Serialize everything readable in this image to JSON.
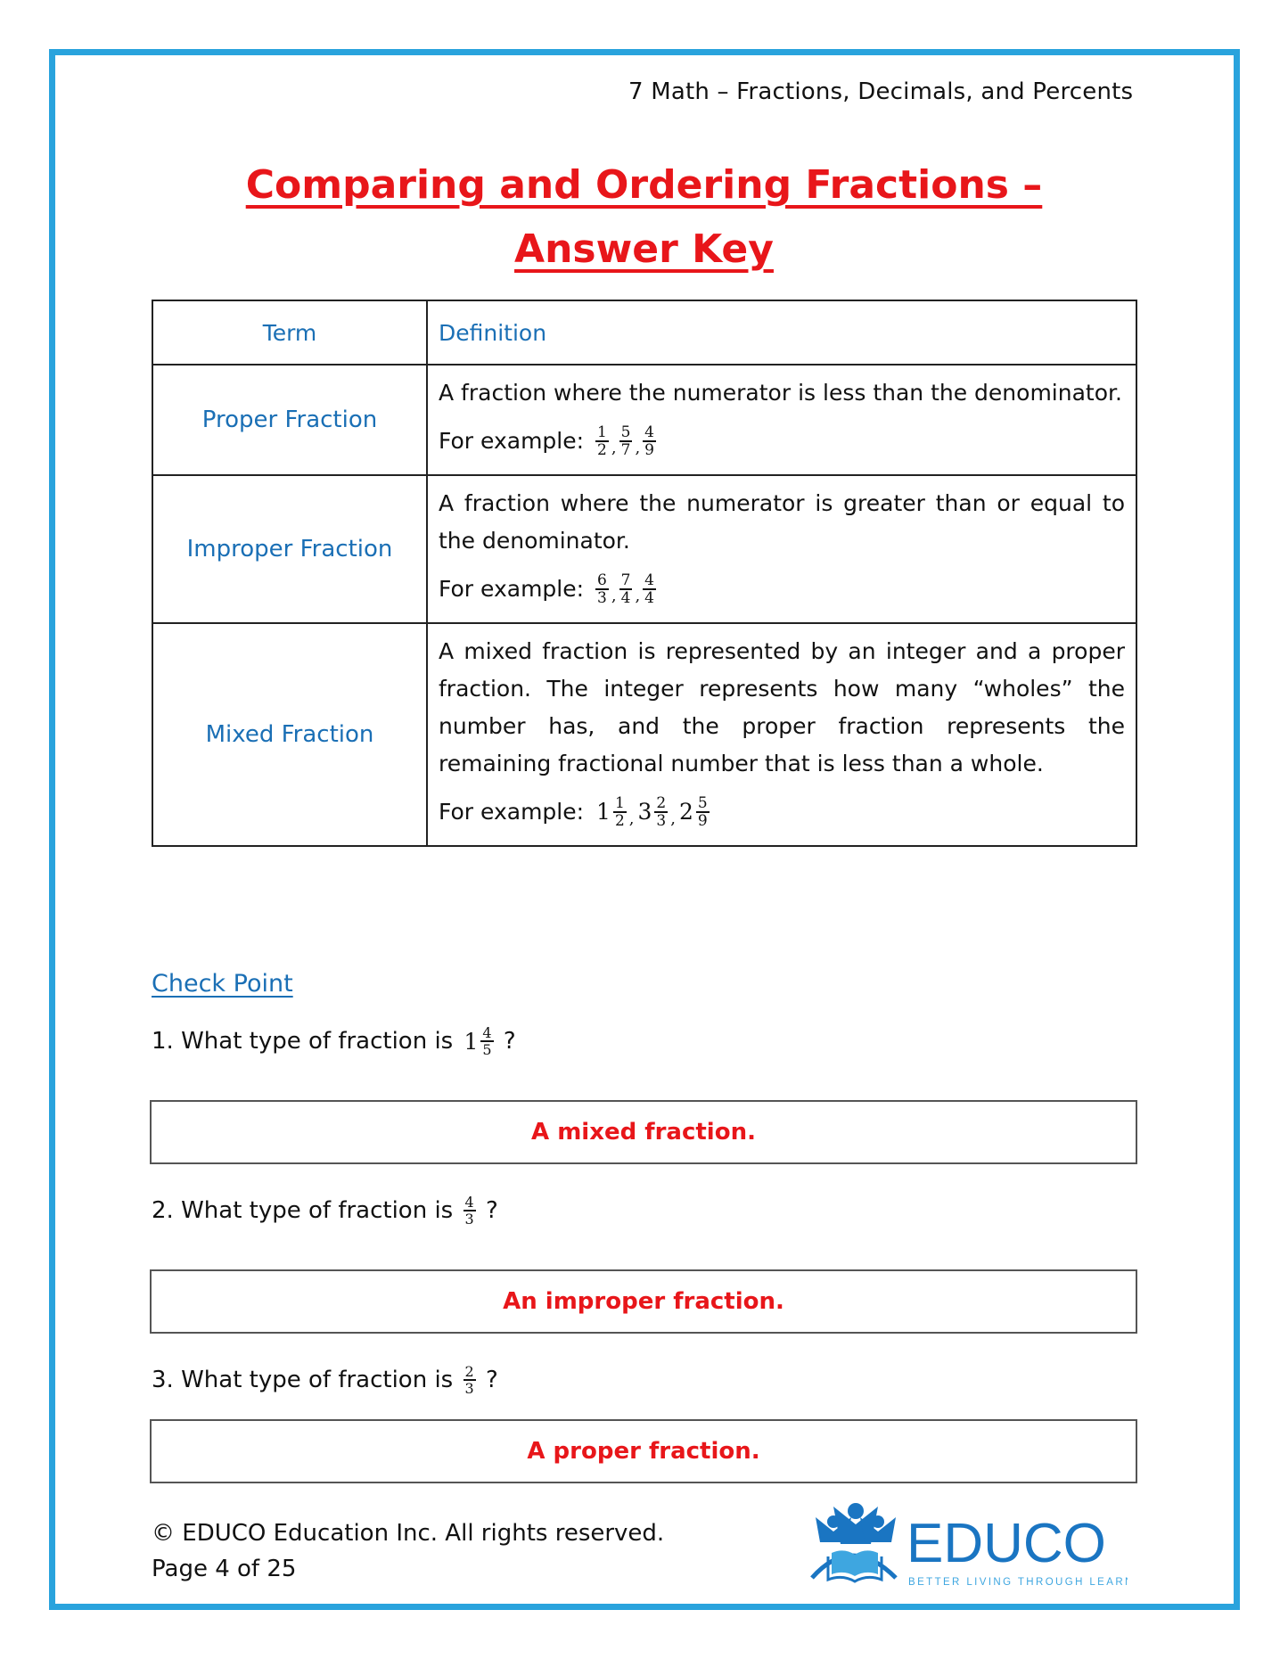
{
  "header": {
    "course_line": "7 Math – Fractions, Decimals, and Percents"
  },
  "title": "Comparing and Ordering Fractions – Answer Key",
  "table": {
    "headers": {
      "term": "Term",
      "definition": "Definition"
    },
    "rows": [
      {
        "term": "Proper Fraction",
        "definition": "A fraction where the numerator is less than the denominator.",
        "example_label": "For example:",
        "examples": [
          {
            "whole": "",
            "num": "1",
            "den": "2"
          },
          {
            "whole": "",
            "num": "5",
            "den": "7"
          },
          {
            "whole": "",
            "num": "4",
            "den": "9"
          }
        ]
      },
      {
        "term": "Improper Fraction",
        "definition": "A fraction where the numerator is greater than or equal to the denominator.",
        "example_label": "For example:",
        "examples": [
          {
            "whole": "",
            "num": "6",
            "den": "3"
          },
          {
            "whole": "",
            "num": "7",
            "den": "4"
          },
          {
            "whole": "",
            "num": "4",
            "den": "4"
          }
        ]
      },
      {
        "term": "Mixed Fraction",
        "definition": "A mixed fraction is represented by an integer and a proper fraction. The integer represents how many “wholes” the number has, and the proper fraction represents the remaining fractional number that is less than a whole.",
        "example_label": "For example:",
        "examples": [
          {
            "whole": "1",
            "num": "1",
            "den": "2"
          },
          {
            "whole": "3",
            "num": "2",
            "den": "3"
          },
          {
            "whole": "2",
            "num": "5",
            "den": "9"
          }
        ]
      }
    ]
  },
  "check_point": {
    "title": "Check Point",
    "questions": [
      {
        "prefix": "1. What type of fraction is",
        "whole": "1",
        "num": "4",
        "den": "5",
        "suffix": "?",
        "answer": "A mixed fraction."
      },
      {
        "prefix": "2. What type of fraction is",
        "whole": "",
        "num": "4",
        "den": "3",
        "suffix": "?",
        "answer": "An improper fraction."
      },
      {
        "prefix": "3. What type of fraction is",
        "whole": "",
        "num": "2",
        "den": "3",
        "suffix": "?",
        "answer": "A proper fraction."
      }
    ]
  },
  "footer": {
    "copyright": "© EDUCO Education Inc. All rights reserved.",
    "page": "Page 4 of 25"
  },
  "logo": {
    "name": "EDUCO",
    "tagline": "BETTER LIVING THROUGH LEARNING",
    "color": "#1a75c2",
    "accent": "#3ea6e0"
  },
  "colors": {
    "border": "#29a3dd",
    "title": "#e8161a",
    "term": "#1a6fb5",
    "answer": "#e8161a"
  }
}
